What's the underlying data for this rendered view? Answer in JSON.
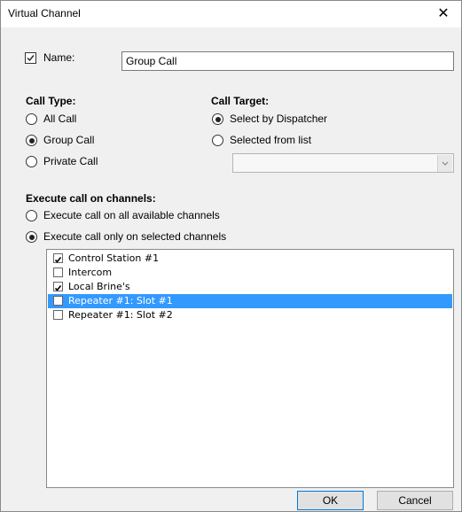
{
  "window": {
    "title": "Virtual Channel",
    "close_glyph": "✕"
  },
  "name_field": {
    "checked": true,
    "label": "Name:",
    "value": "Group Call"
  },
  "call_type": {
    "heading": "Call Type:",
    "options": [
      {
        "label": "All Call",
        "selected": false
      },
      {
        "label": "Group Call",
        "selected": true
      },
      {
        "label": "Private Call",
        "selected": false
      }
    ]
  },
  "call_target": {
    "heading": "Call Target:",
    "options": [
      {
        "label": "Select by Dispatcher",
        "selected": true
      },
      {
        "label": "Selected from list",
        "selected": false
      }
    ],
    "list_value": ""
  },
  "execute": {
    "heading": "Execute call on channels:",
    "options": [
      {
        "label": "Execute call on all available channels",
        "selected": false
      },
      {
        "label": "Execute call only on selected channels",
        "selected": true
      }
    ]
  },
  "channels": [
    {
      "label": "Control Station #1",
      "checked": true,
      "highlighted": false
    },
    {
      "label": "Intercom",
      "checked": false,
      "highlighted": false
    },
    {
      "label": "Local Brine's",
      "checked": true,
      "highlighted": false
    },
    {
      "label": "Repeater #1: Slot #1",
      "checked": false,
      "highlighted": true
    },
    {
      "label": "Repeater #1: Slot #2",
      "checked": false,
      "highlighted": false
    }
  ],
  "buttons": {
    "ok": "OK",
    "cancel": "Cancel"
  },
  "colors": {
    "selection": "#3399ff",
    "dialog_bg": "#f0f0f0",
    "default_button_border": "#0078d7"
  }
}
